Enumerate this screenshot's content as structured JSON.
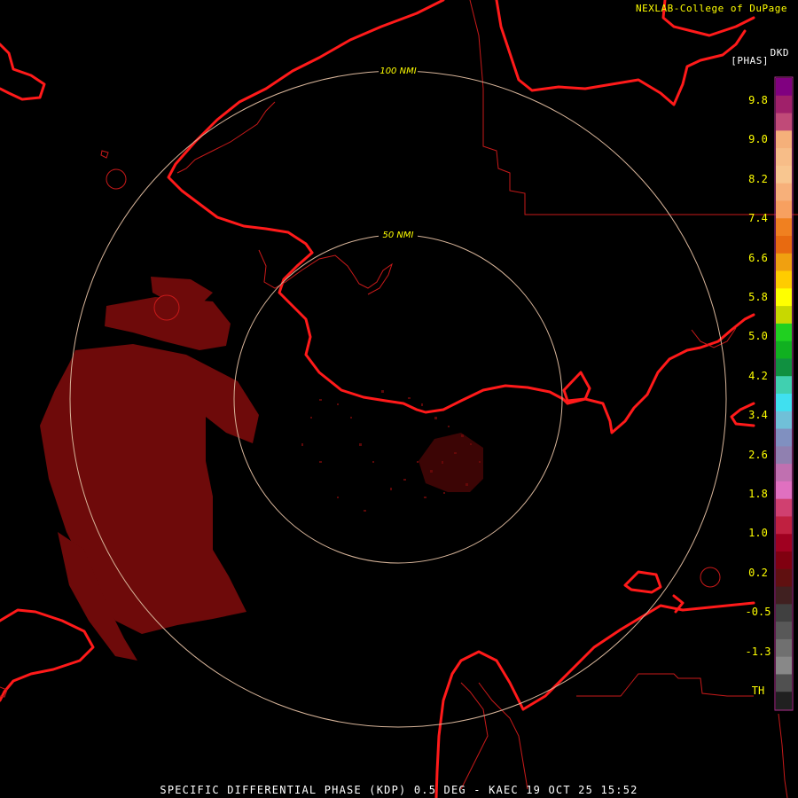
{
  "header": {
    "credit": "NEXLAB-College of DuPage",
    "product_code": "DKD",
    "product_unit": "[PHAS]"
  },
  "range_rings": [
    {
      "label": "50 NMI",
      "radius_nmi": 50
    },
    {
      "label": "100 NMI",
      "radius_nmi": 100
    }
  ],
  "legend": {
    "ticks": [
      "9.8",
      "9.0",
      "8.2",
      "7.4",
      "6.6",
      "5.8",
      "5.0",
      "4.2",
      "3.4",
      "2.6",
      "1.8",
      "1.0",
      "0.2",
      "-0.5",
      "-1.3",
      "TH"
    ],
    "colors": [
      "#800080",
      "#a0206a",
      "#c04a78",
      "#f5b07a",
      "#f7bd88",
      "#f8c690",
      "#f7b07a",
      "#f7a060",
      "#f08020",
      "#e86a10",
      "#f0a010",
      "#ffcc00",
      "#ffff00",
      "#c8d800",
      "#20d020",
      "#10b020",
      "#109040",
      "#40d0b0",
      "#40e0f0",
      "#70c0d8",
      "#8090c0",
      "#9080b0",
      "#c070b0",
      "#e070c0",
      "#d04070",
      "#c02040",
      "#a00020",
      "#800010",
      "#601010",
      "#402020",
      "#404040",
      "#585858",
      "#707070",
      "#888888",
      "#505050",
      "#202020"
    ]
  },
  "colors": {
    "coast": "#ff1a1a",
    "boundary": "#c81a1a",
    "ring": "#d8b59a",
    "echo": "#6e0a0a",
    "ring_label": "#ffff00"
  },
  "footer": {
    "caption": "SPECIFIC DIFFERENTIAL PHASE (KDP) 0.5 DEG - KAEC 19 OCT 25 15:52"
  }
}
